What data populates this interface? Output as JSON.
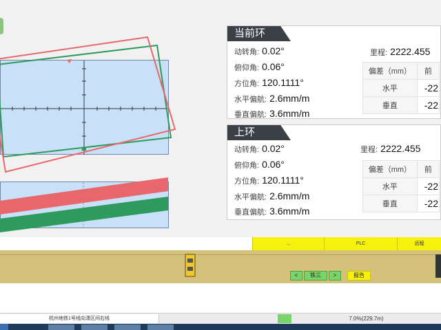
{
  "current_ring": {
    "title": "当前环",
    "rotation_label": "动转角:",
    "rotation_value": "0.02°",
    "pitch_label": "俯仰角:",
    "pitch_value": "0.06°",
    "azimuth_label": "方位角:",
    "azimuth_value": "120.1111°",
    "h_dev_label": "水平偏航:",
    "h_dev_value": "2.6mm/m",
    "v_dev_label": "垂直偏航:",
    "v_dev_value": "3.6mm/m",
    "mileage_label": "里程:",
    "mileage_value": "2222.455",
    "table": {
      "head_label": "偏差（mm）",
      "head_col": "前",
      "rows": [
        {
          "label": "水平",
          "value": "-22"
        },
        {
          "label": "垂直",
          "value": "-22"
        }
      ]
    }
  },
  "prev_ring": {
    "title": "上环",
    "rotation_label": "动转角:",
    "rotation_value": "0.02°",
    "pitch_label": "俯仰角:",
    "pitch_value": "0.06°",
    "azimuth_label": "方位角:",
    "azimuth_value": "120.1111°",
    "h_dev_label": "水平偏航:",
    "h_dev_value": "2.6mm/m",
    "v_dev_label": "垂直偏航:",
    "v_dev_value": "3.6mm/m",
    "mileage_label": "里程:",
    "mileage_value": "2222.455",
    "table": {
      "head_label": "偏差（mm）",
      "head_col": "前",
      "rows": [
        {
          "label": "水平",
          "value": "-22"
        },
        {
          "label": "垂直",
          "value": "-22"
        }
      ]
    }
  },
  "buttons": {
    "btn1": "...",
    "btn2": "PLC",
    "btn3": "远程"
  },
  "nav": {
    "prev": "<",
    "name": "铁三",
    "next": ">",
    "report": "报告"
  },
  "status": {
    "line_name": "杭州地铁1号线向潇区间右线",
    "progress": "7.0%(229.7m)"
  },
  "colors": {
    "red": "#e8676a",
    "green": "#2e9a5e",
    "plot_bg": "#c8e0f8",
    "button_yellow": "#f6f10d"
  },
  "icons": {
    "machine": "tbm-icon"
  }
}
